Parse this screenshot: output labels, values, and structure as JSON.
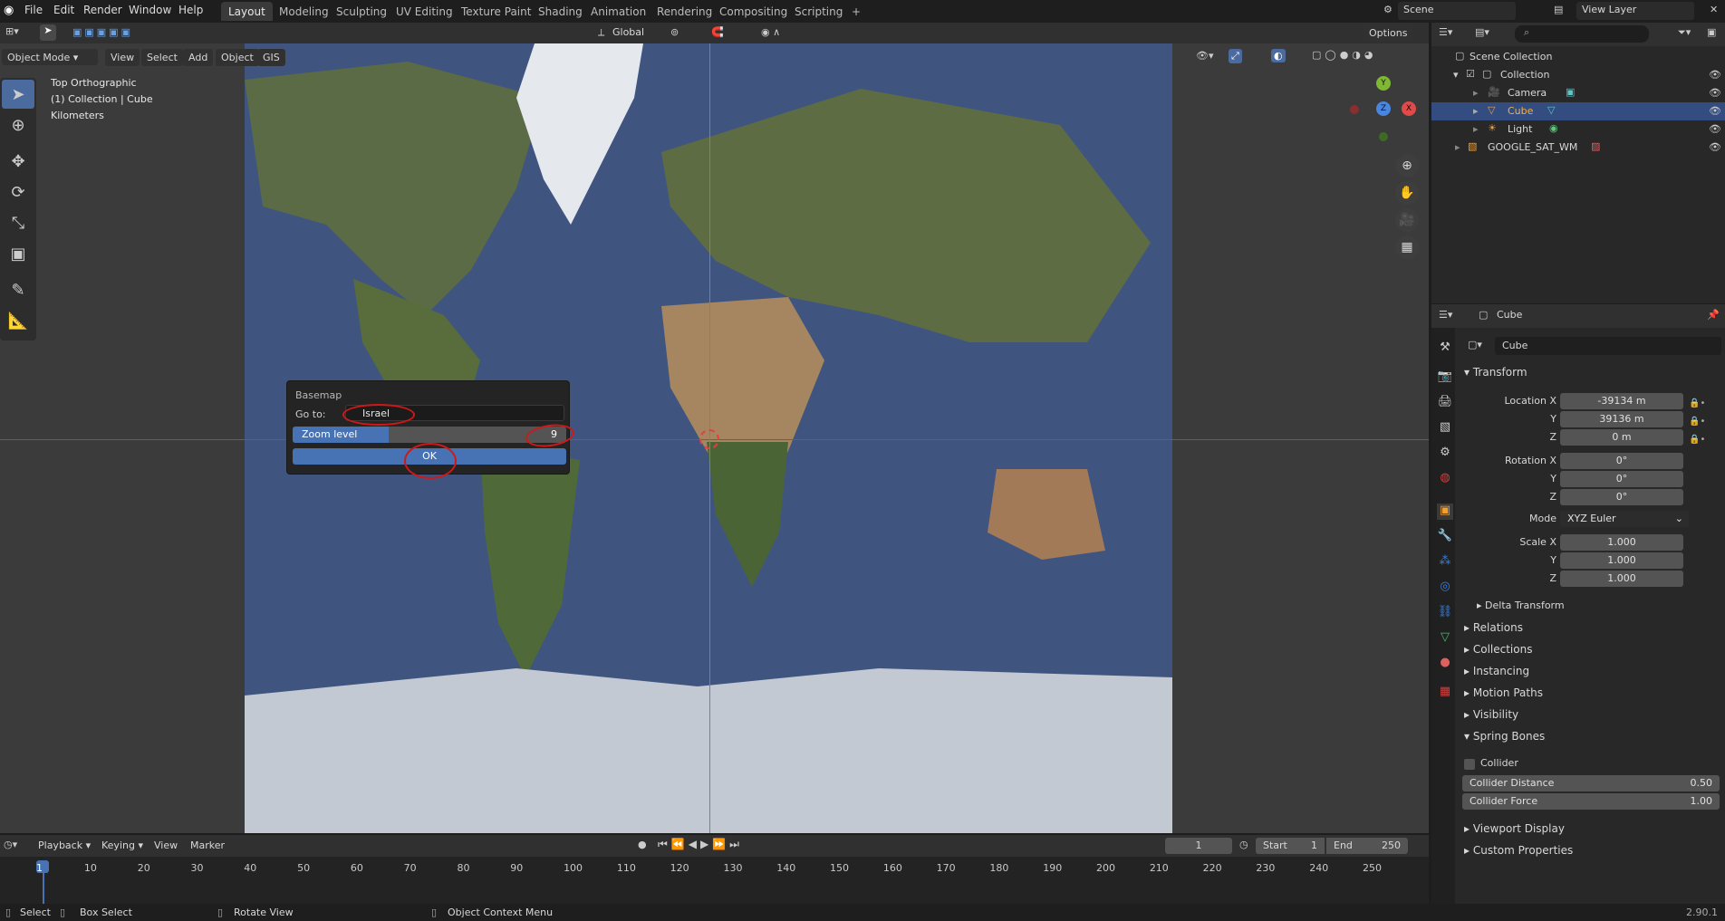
{
  "menus": [
    "File",
    "Edit",
    "Render",
    "Window",
    "Help"
  ],
  "workspaces": [
    "Layout",
    "Modeling",
    "Sculpting",
    "UV Editing",
    "Texture Paint",
    "Shading",
    "Animation",
    "Rendering",
    "Compositing",
    "Scripting"
  ],
  "scene": "Scene",
  "view_layer": "View Layer",
  "viewport_header": {
    "mode": "Object Mode",
    "menus": [
      "View",
      "Select",
      "Add",
      "Object",
      "GIS"
    ],
    "transform": "Global",
    "options": "Options"
  },
  "overlay_text": {
    "view": "Top Orthographic",
    "collection": "(1) Collection | Cube",
    "units": "Kilometers"
  },
  "gizmo": {
    "y": "Y",
    "z": "Z",
    "x": "X"
  },
  "dialog": {
    "title": "Basemap",
    "goto_label": "Go to:",
    "goto_value": "Israel",
    "zoom_label": "Zoom level",
    "zoom_value": "9",
    "ok": "OK"
  },
  "outliner": {
    "root": "Scene Collection",
    "items": [
      "Collection",
      "Camera",
      "Cube",
      "Light",
      "GOOGLE_SAT_WM"
    ]
  },
  "properties": {
    "object_name": "Cube",
    "data_name": "Cube",
    "transform": "Transform",
    "location_label": "Location X",
    "loc_x": "-39134 m",
    "loc_y": "39136 m",
    "loc_z": "0 m",
    "rotation_label": "Rotation X",
    "rot_x": "0°",
    "rot_y": "0°",
    "rot_z": "0°",
    "mode_label": "Mode",
    "mode": "XYZ Euler",
    "scale_label": "Scale X",
    "scale_x": "1.000",
    "scale_y": "1.000",
    "scale_z": "1.000",
    "y": "Y",
    "z": "Z",
    "delta": "Delta Transform",
    "sections": [
      "Relations",
      "Collections",
      "Instancing",
      "Motion Paths",
      "Visibility"
    ],
    "spring": "Spring Bones",
    "collider": "Collider",
    "collider_distance_label": "Collider Distance",
    "collider_distance": "0.50",
    "collider_force_label": "Collider Force",
    "collider_force": "1.00",
    "viewport_display": "Viewport Display",
    "custom_properties": "Custom Properties"
  },
  "timeline": {
    "menus": [
      "Playback",
      "Keying",
      "View",
      "Marker"
    ],
    "current": "1",
    "start_label": "Start",
    "start": "1",
    "end_label": "End",
    "end": "250",
    "ticks": [
      "1",
      "10",
      "20",
      "30",
      "40",
      "50",
      "60",
      "70",
      "80",
      "90",
      "100",
      "110",
      "120",
      "130",
      "140",
      "150",
      "160",
      "170",
      "180",
      "190",
      "200",
      "210",
      "220",
      "230",
      "240",
      "250"
    ]
  },
  "status": {
    "select": "Select",
    "box_select": "Box Select",
    "rotate": "Rotate View",
    "context": "Object Context Menu",
    "version": "2.90.1"
  }
}
